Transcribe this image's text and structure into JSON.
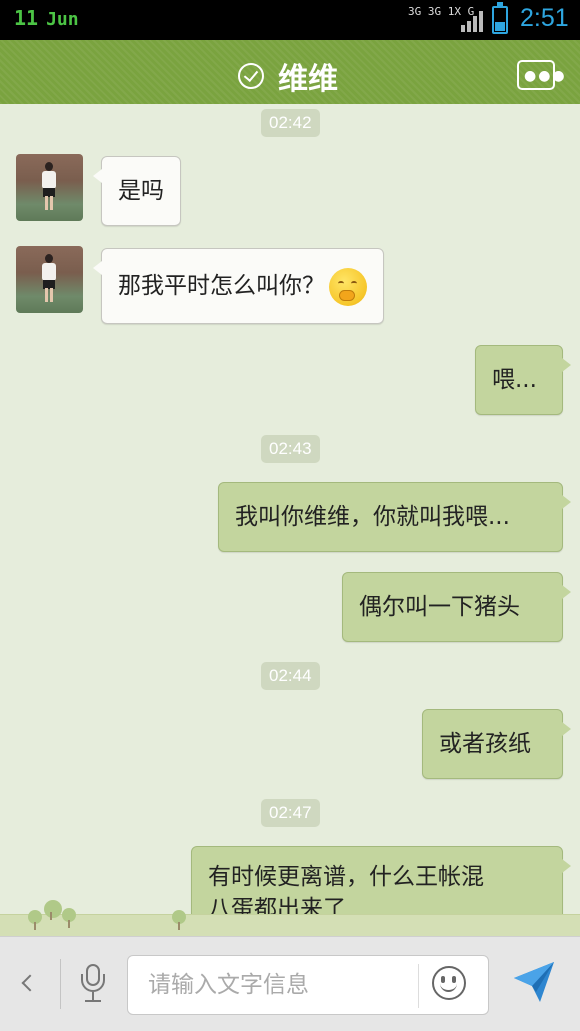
{
  "status_bar": {
    "day": "11",
    "month": "Jun",
    "network": "3G 3G 1X G",
    "time": "2:51",
    "colors": {
      "accent": "#2ea6e0",
      "date": "#4cc445"
    }
  },
  "header": {
    "title": "维维",
    "verified_icon": "check-circle-icon",
    "menu_icon": "more-dots-icon",
    "color": "#7aa33f"
  },
  "messages": [
    {
      "type": "timestamp",
      "text": "02:42"
    },
    {
      "type": "received",
      "text": "是吗"
    },
    {
      "type": "received",
      "text": "那我平时怎么叫你？",
      "emoji": "thinking-face-icon"
    },
    {
      "type": "sent",
      "text": "喂..."
    },
    {
      "type": "timestamp",
      "text": "02:43"
    },
    {
      "type": "sent",
      "text": "我叫你维维，你就叫我喂..."
    },
    {
      "type": "sent",
      "text": "偶尔叫一下猪头"
    },
    {
      "type": "timestamp",
      "text": "02:44"
    },
    {
      "type": "sent",
      "text": "或者孩纸"
    },
    {
      "type": "timestamp",
      "text": "02:47"
    },
    {
      "type": "sent",
      "text_line1": "有时候更离谱，什么王帐混",
      "text_line2": "八蛋都出来了"
    }
  ],
  "input_bar": {
    "placeholder": "请输入文字信息",
    "icons": [
      "back-chevron-icon",
      "mic-icon",
      "smiley-icon",
      "send-icon"
    ]
  },
  "colors": {
    "chat_background": "#e6eddc",
    "sent_bubble": "#c3d59e",
    "received_bubble": "#fbfbf8"
  }
}
